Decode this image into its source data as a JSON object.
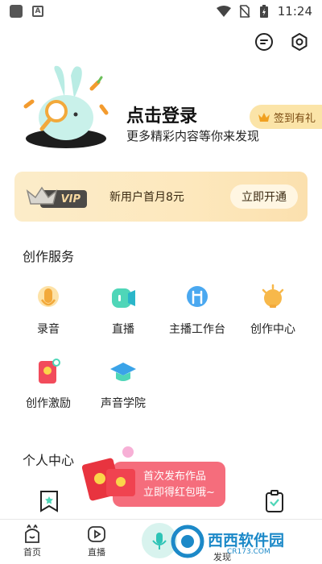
{
  "status_bar": {
    "time": "11:24",
    "a_badge": "A"
  },
  "profile": {
    "login_title": "点击登录",
    "login_subtitle": "更多精彩内容等你来发现",
    "checkin_label": "签到有礼"
  },
  "vip": {
    "badge": "VIP",
    "offer_text": "新用户首月8元",
    "button_label": "立即开通"
  },
  "create_section": {
    "title": "创作服务",
    "items": [
      {
        "label": "录音",
        "icon": "microphone-icon"
      },
      {
        "label": "直播",
        "icon": "live-icon"
      },
      {
        "label": "主播工作台",
        "icon": "workbench-icon"
      },
      {
        "label": "创作中心",
        "icon": "lightbulb-icon"
      },
      {
        "label": "创作激励",
        "icon": "reward-icon"
      },
      {
        "label": "声音学院",
        "icon": "graduation-cap-icon"
      }
    ]
  },
  "personal_section": {
    "title": "个人中心"
  },
  "promo": {
    "line1": "首次发布作品",
    "line2": "立即得红包哦~"
  },
  "tabbar": {
    "tabs": [
      {
        "label": "首页",
        "icon": "home-icon"
      },
      {
        "label": "直播",
        "icon": "play-icon"
      },
      {
        "label": "发现",
        "icon": "discover-icon"
      }
    ]
  },
  "watermark": {
    "title": "西西软件园",
    "sub": "CR173.COM"
  },
  "colors": {
    "vip_gold": "#fde8bd",
    "promo_red": "#f56d7c",
    "brand_teal": "#2ec4b6"
  }
}
